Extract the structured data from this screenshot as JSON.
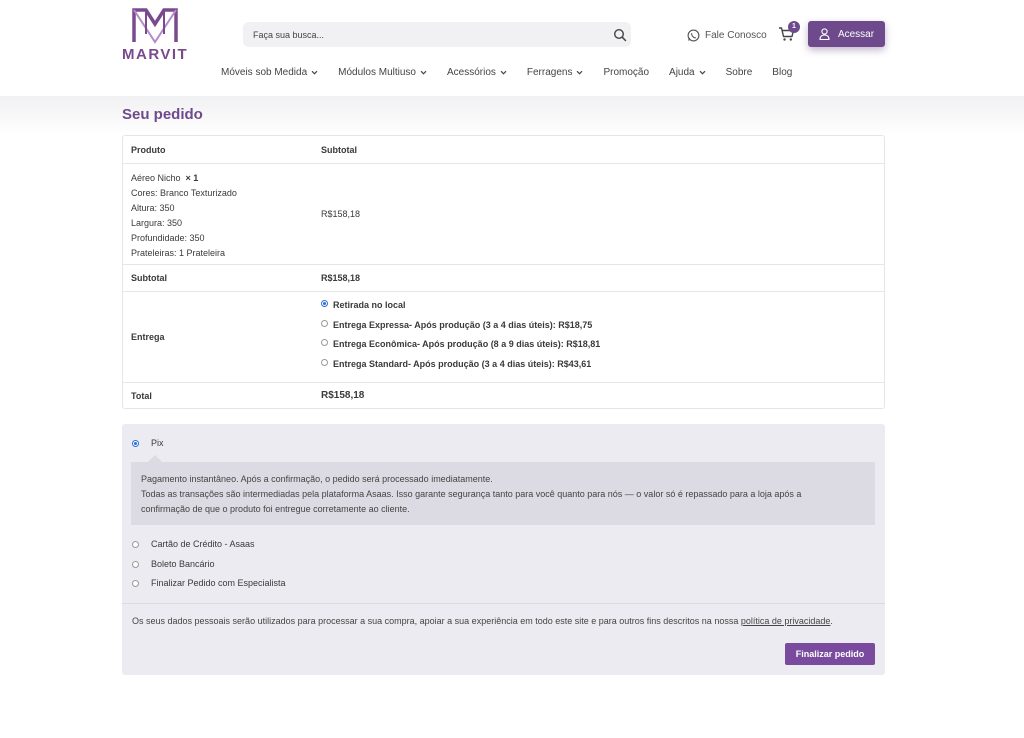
{
  "brand": {
    "name": "MARVIT",
    "accent": "#6e4a8c"
  },
  "search": {
    "placeholder": "Faça sua busca..."
  },
  "header": {
    "contact_label": "Fale Conosco",
    "cart_count": "1",
    "login_label": "Acessar"
  },
  "nav": [
    {
      "label": "Móveis sob Medida",
      "has_dropdown": true
    },
    {
      "label": "Módulos Multiuso",
      "has_dropdown": true
    },
    {
      "label": "Acessórios",
      "has_dropdown": true
    },
    {
      "label": "Ferragens",
      "has_dropdown": true
    },
    {
      "label": "Promoção",
      "has_dropdown": false
    },
    {
      "label": "Ajuda",
      "has_dropdown": true
    },
    {
      "label": "Sobre",
      "has_dropdown": false
    },
    {
      "label": "Blog",
      "has_dropdown": false
    }
  ],
  "order": {
    "title": "Seu pedido",
    "col_product": "Produto",
    "col_subtotal": "Subtotal",
    "item": {
      "name": "Aéreo Nicho",
      "qty": "× 1",
      "meta": [
        "Cores: Branco Texturizado",
        "Altura: 350",
        "Largura: 350",
        "Profundidade: 350",
        "Prateleiras: 1 Prateleira"
      ],
      "price": "R$158,18"
    },
    "subtotal_label": "Subtotal",
    "subtotal_value": "R$158,18",
    "shipping_label": "Entrega",
    "shipping_options": [
      {
        "label": "Retirada no local",
        "selected": true
      },
      {
        "label": "Entrega Expressa- Após produção (3 a 4 dias úteis): R$18,75",
        "selected": false
      },
      {
        "label": "Entrega Econômica- Após produção (8 a 9 dias úteis): R$18,81",
        "selected": false
      },
      {
        "label": "Entrega Standard- Após produção (3 a 4 dias úteis): R$43,61",
        "selected": false
      }
    ],
    "total_label": "Total",
    "total_value": "R$158,18"
  },
  "payment": {
    "methods": [
      {
        "label": "Pix",
        "selected": true
      },
      {
        "label": "Cartão de Crédito - Asaas",
        "selected": false
      },
      {
        "label": "Boleto Bancário",
        "selected": false
      },
      {
        "label": "Finalizar Pedido com Especialista",
        "selected": false
      }
    ],
    "pix_description": [
      "Pagamento instantâneo. Após a confirmação, o pedido será processado imediatamente.",
      "Todas as transações são intermediadas pela plataforma Asaas. Isso garante segurança tanto para você quanto para nós — o valor só é repassado para a loja após a",
      "confirmação de que o produto foi entregue corretamente ao cliente."
    ],
    "privacy_text": "Os seus dados pessoais serão utilizados para processar a sua compra, apoiar a sua experiência em todo este site e para outros fins descritos na nossa ",
    "privacy_link": "política de privacidade",
    "privacy_end": ".",
    "submit_label": "Finalizar pedido"
  }
}
